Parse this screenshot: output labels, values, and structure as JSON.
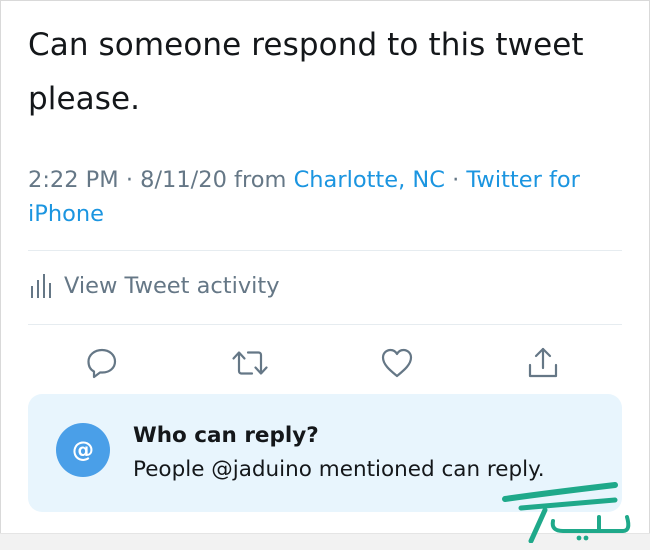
{
  "tweet": {
    "text": "Can someone respond to this tweet please.",
    "time": "2:22 PM",
    "date": "8/11/20",
    "from_label": "from",
    "location": "Charlotte, NC",
    "separator": "·",
    "source": "Twitter for iPhone"
  },
  "activity": {
    "label": "View Tweet activity",
    "icon": "bar-chart-icon"
  },
  "actions": [
    {
      "name": "reply",
      "icon": "comment-icon"
    },
    {
      "name": "retweet",
      "icon": "retweet-icon"
    },
    {
      "name": "like",
      "icon": "heart-icon"
    },
    {
      "name": "share",
      "icon": "share-icon"
    }
  ],
  "reply_card": {
    "badge": "@",
    "title": "Who can reply?",
    "subtitle": "People @jaduino mentioned can reply."
  },
  "colors": {
    "link": "#1b95e0",
    "muted": "#657786",
    "card_bg": "#e8f5fd",
    "badge": "#4a9fe8",
    "watermark": "#1fa98a"
  },
  "watermark": {
    "text": "مدیاتک"
  }
}
